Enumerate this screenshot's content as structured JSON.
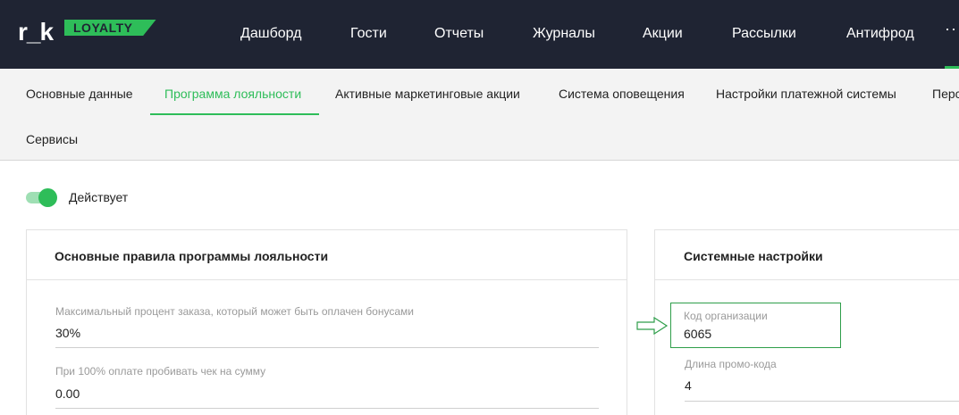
{
  "brand": {
    "logo_text": "r_k",
    "badge_text": "LOYALTY"
  },
  "nav": {
    "items": [
      "Дашборд",
      "Гости",
      "Отчеты",
      "Журналы",
      "Акции",
      "Рассылки",
      "Антифрод"
    ],
    "more": "··"
  },
  "tabs": {
    "items": [
      "Основные данные",
      "Программа лояльности",
      "Активные маркетинговые акции",
      "Система оповещения",
      "Настройки платежной системы",
      "Перс",
      "Сервисы"
    ],
    "active": "Программа лояльности"
  },
  "status": {
    "label": "Действует",
    "enabled": true
  },
  "loyalty_rules": {
    "title": "Основные правила программы лояльности",
    "fields": [
      {
        "label": "Максимальный процент заказа, который может быть оплачен бонусами",
        "value": "30%"
      },
      {
        "label": "При 100% оплате пробивать чек на сумму",
        "value": "0.00"
      }
    ]
  },
  "system_settings": {
    "title": "Системные настройки",
    "fields": [
      {
        "label": "Код организации",
        "value": "6065"
      },
      {
        "label": "Длина промо-кода",
        "value": "4"
      }
    ]
  },
  "colors": {
    "topbar": "#1f2433",
    "accent": "#2ebd59",
    "tabs_bg": "#f3f3f3"
  }
}
